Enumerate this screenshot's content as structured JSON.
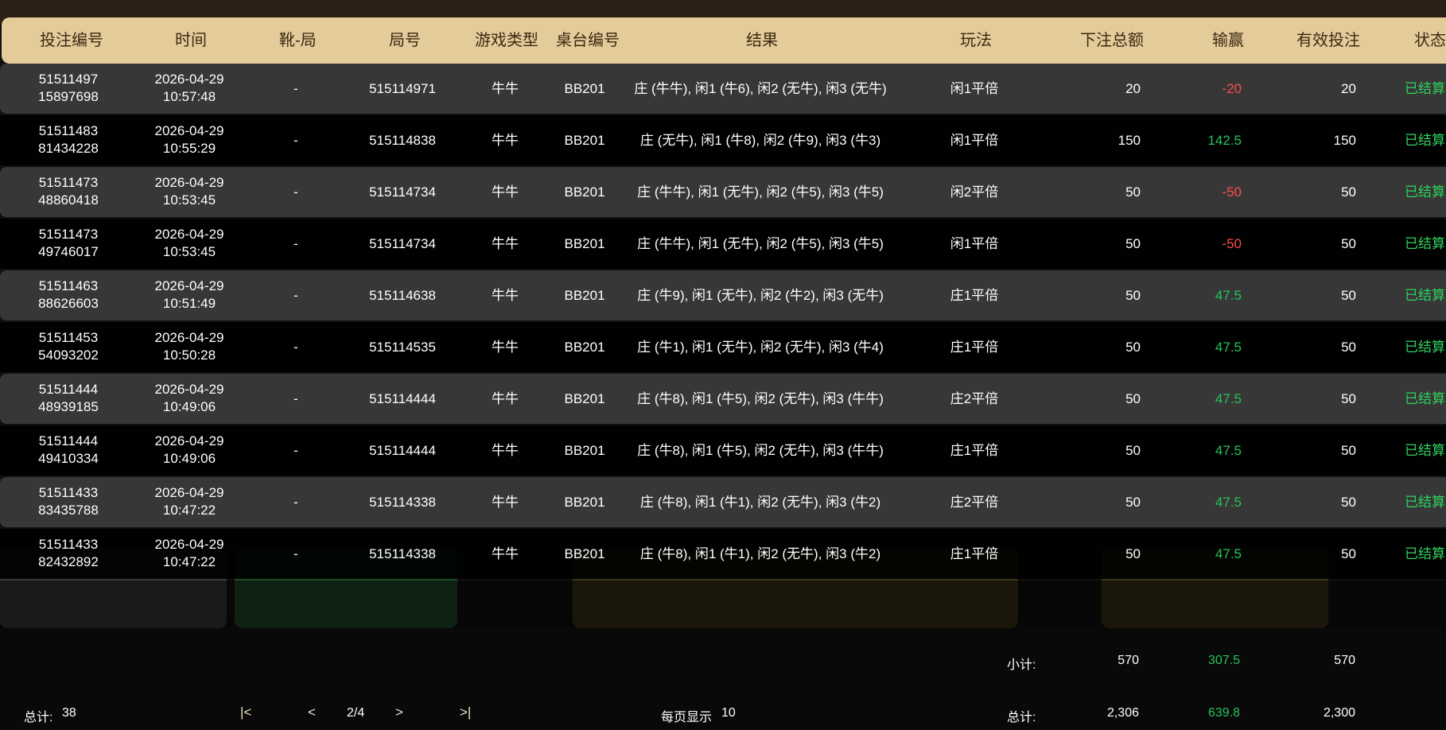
{
  "columns": {
    "bet_id": "投注编号",
    "time": "时间",
    "shoe_round": "靴-局",
    "round_no": "局号",
    "game_type": "游戏类型",
    "table_no": "桌台编号",
    "result": "结果",
    "play": "玩法",
    "bet_total": "下注总额",
    "win_loss": "输赢",
    "valid_bet": "有效投注",
    "status": "状态"
  },
  "rows": [
    {
      "id1": "51511497",
      "id2": "15897698",
      "date": "2026-04-29",
      "clock": "10:57:48",
      "shoe": "-",
      "round": "515114971",
      "game": "牛牛",
      "table": "BB201",
      "result": "庄 (牛牛), 闲1 (牛6), 闲2 (无牛), 闲3 (无牛)",
      "play": "闲1平倍",
      "bet": "20",
      "winloss": "-20",
      "sign": "neg",
      "valid": "20",
      "status": "已结算"
    },
    {
      "id1": "51511483",
      "id2": "81434228",
      "date": "2026-04-29",
      "clock": "10:55:29",
      "shoe": "-",
      "round": "515114838",
      "game": "牛牛",
      "table": "BB201",
      "result": "庄 (无牛), 闲1 (牛8), 闲2 (牛9), 闲3 (牛3)",
      "play": "闲1平倍",
      "bet": "150",
      "winloss": "142.5",
      "sign": "pos",
      "valid": "150",
      "status": "已结算"
    },
    {
      "id1": "51511473",
      "id2": "48860418",
      "date": "2026-04-29",
      "clock": "10:53:45",
      "shoe": "-",
      "round": "515114734",
      "game": "牛牛",
      "table": "BB201",
      "result": "庄 (牛牛), 闲1 (无牛), 闲2 (牛5), 闲3 (牛5)",
      "play": "闲2平倍",
      "bet": "50",
      "winloss": "-50",
      "sign": "neg",
      "valid": "50",
      "status": "已结算"
    },
    {
      "id1": "51511473",
      "id2": "49746017",
      "date": "2026-04-29",
      "clock": "10:53:45",
      "shoe": "-",
      "round": "515114734",
      "game": "牛牛",
      "table": "BB201",
      "result": "庄 (牛牛), 闲1 (无牛), 闲2 (牛5), 闲3 (牛5)",
      "play": "闲1平倍",
      "bet": "50",
      "winloss": "-50",
      "sign": "neg",
      "valid": "50",
      "status": "已结算"
    },
    {
      "id1": "51511463",
      "id2": "88626603",
      "date": "2026-04-29",
      "clock": "10:51:49",
      "shoe": "-",
      "round": "515114638",
      "game": "牛牛",
      "table": "BB201",
      "result": "庄 (牛9), 闲1 (无牛), 闲2 (牛2), 闲3 (无牛)",
      "play": "庄1平倍",
      "bet": "50",
      "winloss": "47.5",
      "sign": "pos",
      "valid": "50",
      "status": "已结算"
    },
    {
      "id1": "51511453",
      "id2": "54093202",
      "date": "2026-04-29",
      "clock": "10:50:28",
      "shoe": "-",
      "round": "515114535",
      "game": "牛牛",
      "table": "BB201",
      "result": "庄 (牛1), 闲1 (无牛), 闲2 (无牛), 闲3 (牛4)",
      "play": "庄1平倍",
      "bet": "50",
      "winloss": "47.5",
      "sign": "pos",
      "valid": "50",
      "status": "已结算"
    },
    {
      "id1": "51511444",
      "id2": "48939185",
      "date": "2026-04-29",
      "clock": "10:49:06",
      "shoe": "-",
      "round": "515114444",
      "game": "牛牛",
      "table": "BB201",
      "result": "庄 (牛8), 闲1 (牛5), 闲2 (无牛), 闲3 (牛牛)",
      "play": "庄2平倍",
      "bet": "50",
      "winloss": "47.5",
      "sign": "pos",
      "valid": "50",
      "status": "已结算"
    },
    {
      "id1": "51511444",
      "id2": "49410334",
      "date": "2026-04-29",
      "clock": "10:49:06",
      "shoe": "-",
      "round": "515114444",
      "game": "牛牛",
      "table": "BB201",
      "result": "庄 (牛8), 闲1 (牛5), 闲2 (无牛), 闲3 (牛牛)",
      "play": "庄1平倍",
      "bet": "50",
      "winloss": "47.5",
      "sign": "pos",
      "valid": "50",
      "status": "已结算"
    },
    {
      "id1": "51511433",
      "id2": "83435788",
      "date": "2026-04-29",
      "clock": "10:47:22",
      "shoe": "-",
      "round": "515114338",
      "game": "牛牛",
      "table": "BB201",
      "result": "庄 (牛8), 闲1 (牛1), 闲2 (无牛), 闲3 (牛2)",
      "play": "庄2平倍",
      "bet": "50",
      "winloss": "47.5",
      "sign": "pos",
      "valid": "50",
      "status": "已结算"
    },
    {
      "id1": "51511433",
      "id2": "82432892",
      "date": "2026-04-29",
      "clock": "10:47:22",
      "shoe": "-",
      "round": "515114338",
      "game": "牛牛",
      "table": "BB201",
      "result": "庄 (牛8), 闲1 (牛1), 闲2 (无牛), 闲3 (牛2)",
      "play": "庄1平倍",
      "bet": "50",
      "winloss": "47.5",
      "sign": "pos",
      "valid": "50",
      "status": "已结算"
    }
  ],
  "footer": {
    "total_count_label": "总计:",
    "total_count": "38",
    "first_page": "|<",
    "prev_page": "<",
    "page_indicator": "2/4",
    "next_page": ">",
    "last_page": ">|",
    "per_page_label": "每页显示",
    "per_page": "10",
    "subtotal_label": "小计:",
    "subtotal_bet": "570",
    "subtotal_winloss": "307.5",
    "subtotal_valid": "570",
    "grand_total_label": "总计:",
    "grand_total_bet": "2,306",
    "grand_total_winloss": "639.8",
    "grand_total_valid": "2,300"
  },
  "colors": {
    "header_bg": "#e3cb9a",
    "negative": "#ff4d4d",
    "positive": "#27c45a",
    "status_settled": "#2fd35e"
  }
}
